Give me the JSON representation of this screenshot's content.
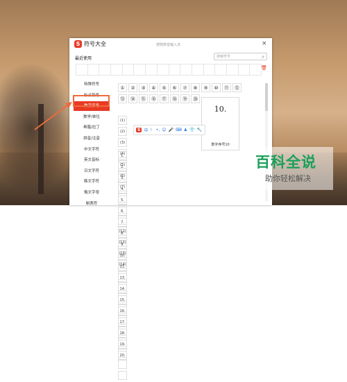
{
  "window": {
    "title": "符号大全",
    "subtitle": "搜狗拼音输入法",
    "close": "×"
  },
  "recent_label": "最近使用",
  "search": {
    "placeholder": "搜索符号"
  },
  "sidebar": {
    "items": [
      {
        "label": "特殊符号"
      },
      {
        "label": "标点符号"
      },
      {
        "label": "数字序号",
        "active": true
      },
      {
        "label": "数学/单位"
      },
      {
        "label": "希腊/拉丁"
      },
      {
        "label": "拼音/注音"
      },
      {
        "label": "中文字符"
      },
      {
        "label": "英文音标"
      },
      {
        "label": "日文字符"
      },
      {
        "label": "韩文字符"
      },
      {
        "label": "俄文字母"
      },
      {
        "label": "制表符"
      }
    ]
  },
  "grid1": {
    "row1": [
      "①",
      "②",
      "③",
      "④",
      "⑤",
      "⑥",
      "⑦",
      "⑧",
      "⑨",
      "⑩",
      "⑪",
      "⑫"
    ],
    "row2": [
      "⑬",
      "⑭",
      "⑮",
      "⑯",
      "⑰",
      "⑱",
      "⑲",
      "⑳"
    ]
  },
  "grid2": {
    "row1": [
      "(1)",
      "(2)",
      "(3)",
      "(4)",
      "(5)",
      "(6)",
      "(7)",
      "",
      "",
      "",
      "(11)",
      "(12)"
    ],
    "row2": [
      "(13)",
      "(14)",
      "",
      "",
      "",
      "",
      "",
      "",
      "",
      "",
      "",
      ""
    ]
  },
  "grid3": {
    "row1": [
      "1.",
      "2.",
      "3.",
      "4.",
      "5.",
      "6.",
      "7.",
      "8.",
      "9.",
      "10.",
      "11."
    ],
    "row2": [
      "13.",
      "14.",
      "15.",
      "16.",
      "17.",
      "18.",
      "19.",
      "20."
    ]
  },
  "preview": {
    "symbol": "10.",
    "name": "数字序号10"
  },
  "toolbar": {
    "logo": "S",
    "mode": "中"
  },
  "brand": {
    "title": "百科全说",
    "subtitle": "助你轻松解决"
  },
  "colors": {
    "accent": "#e83a24",
    "brand_green": "#1aa05a",
    "highlight": "#ef6a3a"
  }
}
